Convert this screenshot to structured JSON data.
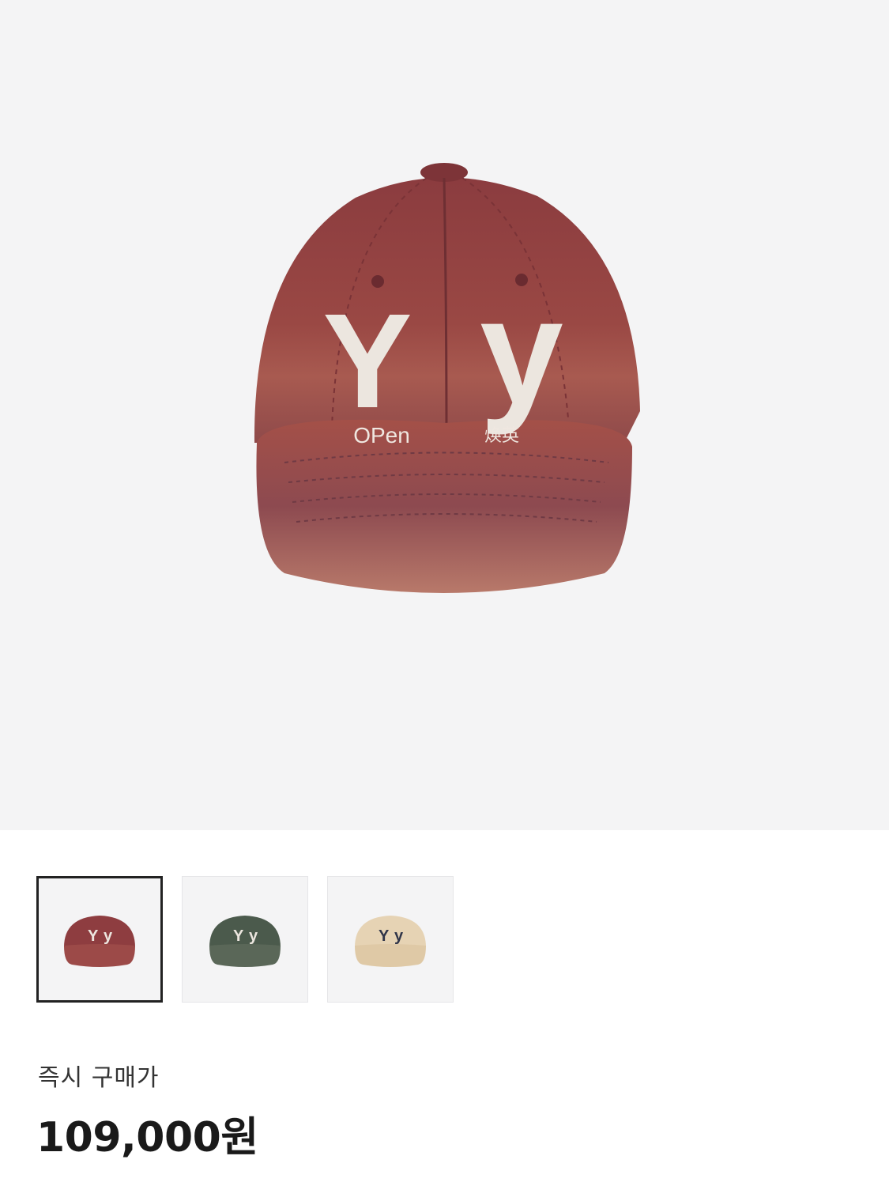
{
  "product": {
    "main_image": {
      "alt": "",
      "color": "#8e3d40",
      "letter_left": "Y",
      "letter_right": "y",
      "embroidery_left": "OPen",
      "embroidery_right": "焕英"
    },
    "thumbnails": [
      {
        "name": "red",
        "color": "#8e3d40",
        "selected": true
      },
      {
        "name": "green",
        "color": "#4b5a4c",
        "selected": false
      },
      {
        "name": "beige",
        "color": "#e6d3b4",
        "selected": false
      }
    ]
  },
  "price": {
    "label": "즉시 구매가",
    "value": "109,000원"
  },
  "colors": {
    "background": "#f4f4f5",
    "accent_border": "#222222",
    "text_primary": "#1a1a1a"
  }
}
